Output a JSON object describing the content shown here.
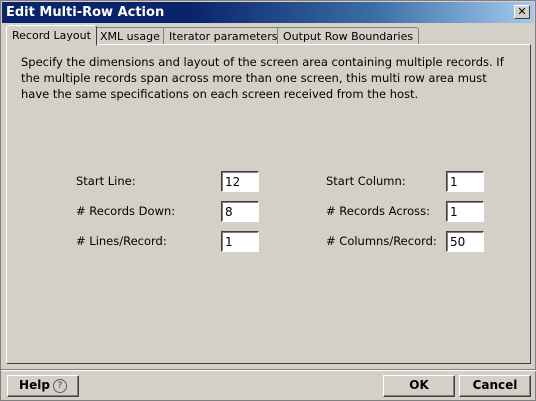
{
  "window": {
    "title": "Edit Multi-Row Action",
    "close_label": "✕"
  },
  "tabs": [
    {
      "label": "Record Layout",
      "active": true
    },
    {
      "label": "XML usage",
      "active": false
    },
    {
      "label": "Iterator parameters",
      "active": false
    },
    {
      "label": "Output Row Boundaries",
      "active": false
    }
  ],
  "description": "Specify the dimensions and layout of the screen area containing multiple records. If the multiple records span across more than one screen, this multi row area must have the same specifications on each screen received from the host.",
  "fields": {
    "start_line": {
      "label": "Start Line:",
      "value": "12"
    },
    "records_down": {
      "label": "# Records Down:",
      "value": "8"
    },
    "lines_per_record": {
      "label": "# Lines/Record:",
      "value": "1"
    },
    "start_column": {
      "label": "Start Column:",
      "value": "1"
    },
    "records_across": {
      "label": "# Records Across:",
      "value": "1"
    },
    "columns_per_record": {
      "label": "# Columns/Record:",
      "value": "50"
    }
  },
  "buttons": {
    "help": "Help",
    "help_icon": "?",
    "ok": "OK",
    "cancel": "Cancel"
  }
}
